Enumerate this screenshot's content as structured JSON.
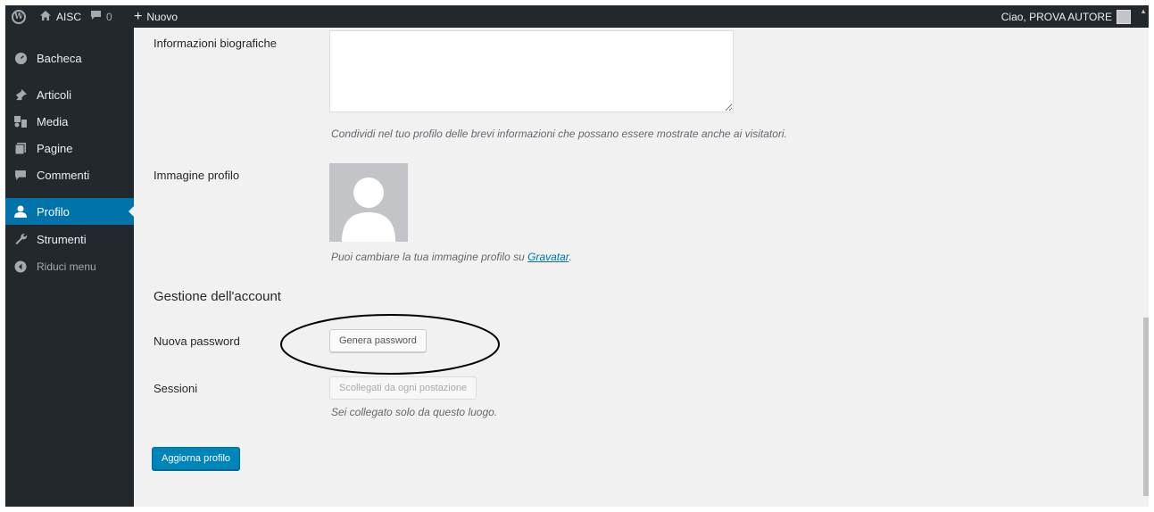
{
  "adminbar": {
    "site_name": "AISC",
    "comment_count": "0",
    "new_label": "Nuovo",
    "howdy": "Ciao, PROVA AUTORE"
  },
  "sidebar": {
    "items": [
      {
        "label": "Bacheca",
        "icon": "dashboard-icon"
      },
      {
        "label": "Articoli",
        "icon": "pin-icon"
      },
      {
        "label": "Media",
        "icon": "media-icon"
      },
      {
        "label": "Pagine",
        "icon": "pages-icon"
      },
      {
        "label": "Commenti",
        "icon": "comments-icon"
      },
      {
        "label": "Profilo",
        "icon": "user-icon",
        "active": true
      },
      {
        "label": "Strumenti",
        "icon": "wrench-icon"
      },
      {
        "label": "Riduci menu",
        "icon": "collapse-icon"
      }
    ]
  },
  "bio": {
    "label": "Informazioni biografiche",
    "value": "",
    "description": "Condividi nel tuo profilo delle brevi informazioni che possano essere mostrate anche ai visitatori."
  },
  "avatar": {
    "label": "Immagine profilo",
    "description_prefix": "Puoi cambiare la tua immagine profilo su",
    "link": "Gravatar",
    "description_suffix": "."
  },
  "account": {
    "title": "Gestione dell'account",
    "password_label": "Nuova password",
    "generate_button": "Genera password",
    "sessions_label": "Sessioni",
    "logout_button": "Scollegati da ogni postazione",
    "sessions_note": "Sei collegato solo da questo luogo."
  },
  "submit_label": "Aggiorna profilo",
  "colors": {
    "sidebar_bg": "#23282d",
    "active_bg": "#0073aa",
    "primary_button": "#0085ba",
    "content_bg": "#f1f1f1"
  }
}
